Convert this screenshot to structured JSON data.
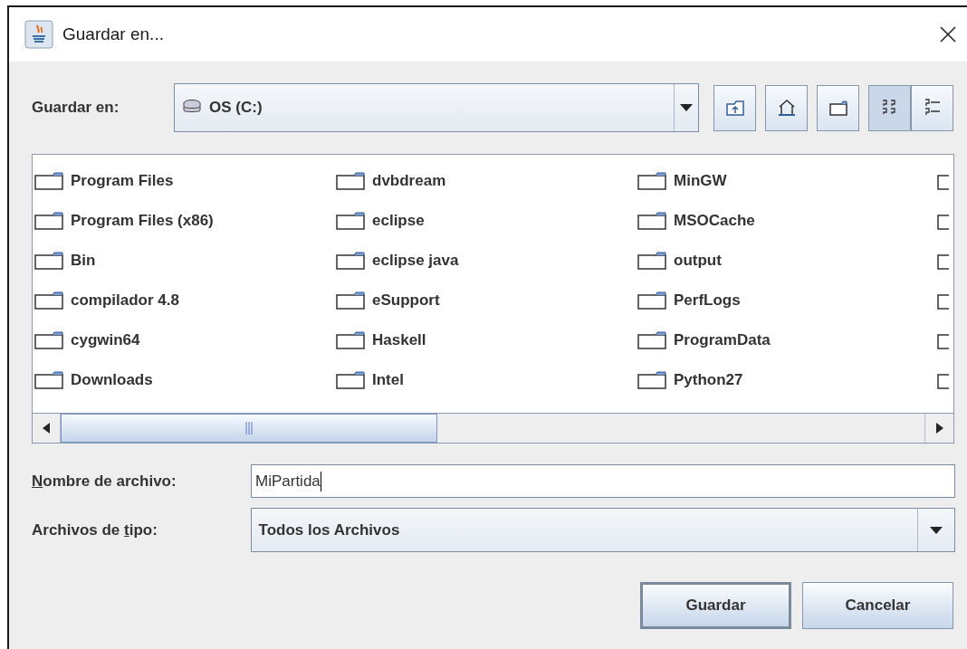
{
  "window": {
    "title": "Guardar en..."
  },
  "look_in": {
    "label": "Guardar en:",
    "value": "OS (C:)"
  },
  "toolbar": [
    {
      "kind": "up"
    },
    {
      "kind": "home"
    },
    {
      "kind": "new-folder"
    },
    {
      "kind": "list",
      "selected": true
    },
    {
      "kind": "details",
      "selected": false
    }
  ],
  "files": {
    "columns": [
      [
        "Program Files",
        "Program Files (x86)",
        "Bin",
        "compilador 4.8",
        "cygwin64",
        "Downloads"
      ],
      [
        "dvbdream",
        "eclipse",
        "eclipse java",
        "eSupport",
        "Haskell",
        "Intel"
      ],
      [
        "MinGW",
        "MSOCache",
        "output",
        "PerfLogs",
        "ProgramData",
        "Python27"
      ]
    ]
  },
  "file_name": {
    "label_parts": {
      "key": "N",
      "after": "ombre de archivo:"
    },
    "value": "MiPartida"
  },
  "file_type": {
    "label_parts": {
      "before": "Archivos de ",
      "key": "t",
      "after": "ipo:"
    },
    "value": "Todos los Archivos"
  },
  "buttons": [
    {
      "label": "Guardar",
      "default": true
    },
    {
      "label": "Cancelar",
      "default": false
    }
  ]
}
